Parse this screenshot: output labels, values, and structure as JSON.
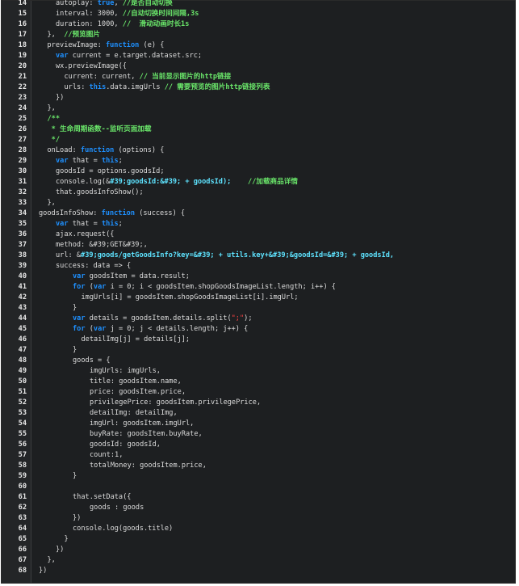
{
  "editor": {
    "lines": [
      {
        "n": "14",
        "indent": 2,
        "tokens": [
          {
            "t": "autoplay: "
          },
          {
            "t": "true",
            "c": "bool"
          },
          {
            "t": ", "
          },
          {
            "t": "//是否自动切换",
            "c": "cm"
          }
        ]
      },
      {
        "n": "15",
        "indent": 2,
        "tokens": [
          {
            "t": "interval: 3000, "
          },
          {
            "t": "//自动切换时间间隔,3s",
            "c": "cm"
          }
        ]
      },
      {
        "n": "16",
        "indent": 2,
        "tokens": [
          {
            "t": "duration: 1000, "
          },
          {
            "t": "//  滑动动画时长1s",
            "c": "cm"
          }
        ]
      },
      {
        "n": "17",
        "indent": 1,
        "tokens": [
          {
            "t": "},  "
          },
          {
            "t": "//预览图片",
            "c": "cm"
          }
        ]
      },
      {
        "n": "18",
        "indent": 1,
        "tokens": [
          {
            "t": "previewImage: "
          },
          {
            "t": "function",
            "c": "kw"
          },
          {
            "t": " (e) {"
          }
        ]
      },
      {
        "n": "19",
        "indent": 2,
        "tokens": [
          {
            "t": "var",
            "c": "kw"
          },
          {
            "t": " current = e.target.dataset.src;"
          }
        ]
      },
      {
        "n": "20",
        "indent": 2,
        "tokens": [
          {
            "t": "wx.previewImage({"
          }
        ]
      },
      {
        "n": "21",
        "indent": 3,
        "tokens": [
          {
            "t": "current: current, "
          },
          {
            "t": "// 当前显示图片的http链接",
            "c": "cm"
          }
        ]
      },
      {
        "n": "22",
        "indent": 3,
        "tokens": [
          {
            "t": "urls: "
          },
          {
            "t": "this",
            "c": "kw"
          },
          {
            "t": ".data.imgUrls "
          },
          {
            "t": "// 需要预览的图片http链接列表",
            "c": "cm"
          }
        ]
      },
      {
        "n": "23",
        "indent": 2,
        "tokens": [
          {
            "t": "})"
          }
        ]
      },
      {
        "n": "24",
        "indent": 1,
        "tokens": [
          {
            "t": "},"
          }
        ]
      },
      {
        "n": "25",
        "indent": 1,
        "tokens": [
          {
            "t": "/**",
            "c": "cm"
          }
        ]
      },
      {
        "n": "26",
        "indent": 1,
        "tokens": [
          {
            "t": " * 生命周期函数--监听页面加载",
            "c": "cm"
          }
        ]
      },
      {
        "n": "27",
        "indent": 1,
        "tokens": [
          {
            "t": " */",
            "c": "cm"
          }
        ]
      },
      {
        "n": "28",
        "indent": 1,
        "tokens": [
          {
            "t": "onLoad: "
          },
          {
            "t": "function",
            "c": "kw"
          },
          {
            "t": " (options) {"
          }
        ]
      },
      {
        "n": "29",
        "indent": 2,
        "tokens": [
          {
            "t": "var",
            "c": "kw"
          },
          {
            "t": " that = "
          },
          {
            "t": "this",
            "c": "kw"
          },
          {
            "t": ";"
          }
        ]
      },
      {
        "n": "30",
        "indent": 2,
        "tokens": [
          {
            "t": "goodsId = options.goodsId;"
          }
        ]
      },
      {
        "n": "31",
        "indent": 2,
        "tokens": [
          {
            "t": "console.log(&"
          },
          {
            "t": "#39;goodsId:&#39; + goodsId);",
            "c": "cy"
          },
          {
            "t": "    "
          },
          {
            "t": "//加载商品详情",
            "c": "cm"
          }
        ]
      },
      {
        "n": "32",
        "indent": 2,
        "tokens": [
          {
            "t": "that.goodsInfoShow();"
          }
        ]
      },
      {
        "n": "33",
        "indent": 1,
        "tokens": [
          {
            "t": "},"
          }
        ]
      },
      {
        "n": "34",
        "indent": 0,
        "tokens": [
          {
            "t": "goodsInfoShow: "
          },
          {
            "t": "function",
            "c": "kw"
          },
          {
            "t": " (success) {"
          }
        ]
      },
      {
        "n": "35",
        "indent": 2,
        "tokens": [
          {
            "t": "var",
            "c": "kw"
          },
          {
            "t": " that = "
          },
          {
            "t": "this",
            "c": "kw"
          },
          {
            "t": ";"
          }
        ]
      },
      {
        "n": "36",
        "indent": 2,
        "tokens": [
          {
            "t": "ajax.request({"
          }
        ]
      },
      {
        "n": "37",
        "indent": 2,
        "tokens": [
          {
            "t": "method: &#39;GET&#39;,"
          }
        ]
      },
      {
        "n": "38",
        "indent": 2,
        "tokens": [
          {
            "t": "url: &"
          },
          {
            "t": "#39;goods/getGoodsInfo?key=&#39; + utils.key+&#39;&goodsId=&#39; + goodsId,",
            "c": "cy"
          }
        ]
      },
      {
        "n": "39",
        "indent": 2,
        "tokens": [
          {
            "t": "success: data => {"
          }
        ]
      },
      {
        "n": "40",
        "indent": 4,
        "tokens": [
          {
            "t": "var",
            "c": "kw"
          },
          {
            "t": " goodsItem = data.result;"
          }
        ]
      },
      {
        "n": "41",
        "indent": 4,
        "tokens": [
          {
            "t": "for",
            "c": "kw"
          },
          {
            "t": " ("
          },
          {
            "t": "var",
            "c": "kw"
          },
          {
            "t": " i = 0; i < goodsItem.shopGoodsImageList.length; i++) {"
          }
        ]
      },
      {
        "n": "42",
        "indent": 5,
        "tokens": [
          {
            "t": "imgUrls[i] = goodsItem.shopGoodsImageList[i].imgUrl;"
          }
        ]
      },
      {
        "n": "43",
        "indent": 4,
        "tokens": [
          {
            "t": "}"
          }
        ]
      },
      {
        "n": "44",
        "indent": 4,
        "tokens": [
          {
            "t": "var",
            "c": "kw"
          },
          {
            "t": " details = goodsItem.details.split("
          },
          {
            "t": "\";\"",
            "c": "str"
          },
          {
            "t": ");"
          }
        ]
      },
      {
        "n": "45",
        "indent": 4,
        "tokens": [
          {
            "t": "for",
            "c": "kw"
          },
          {
            "t": " ("
          },
          {
            "t": "var",
            "c": "kw"
          },
          {
            "t": " j = 0; j < details.length; j++) {"
          }
        ]
      },
      {
        "n": "46",
        "indent": 5,
        "tokens": [
          {
            "t": "detailImg[j] = details[j];"
          }
        ]
      },
      {
        "n": "47",
        "indent": 4,
        "tokens": [
          {
            "t": "}"
          }
        ]
      },
      {
        "n": "48",
        "indent": 4,
        "tokens": [
          {
            "t": "goods = {"
          }
        ]
      },
      {
        "n": "49",
        "indent": 6,
        "tokens": [
          {
            "t": "imgUrls: imgUrls,"
          }
        ]
      },
      {
        "n": "50",
        "indent": 6,
        "tokens": [
          {
            "t": "title: goodsItem.name,"
          }
        ]
      },
      {
        "n": "51",
        "indent": 6,
        "tokens": [
          {
            "t": "price: goodsItem.price,"
          }
        ]
      },
      {
        "n": "52",
        "indent": 6,
        "tokens": [
          {
            "t": "privilegePrice: goodsItem.privilegePrice,"
          }
        ]
      },
      {
        "n": "53",
        "indent": 6,
        "tokens": [
          {
            "t": "detailImg: detailImg,"
          }
        ]
      },
      {
        "n": "54",
        "indent": 6,
        "tokens": [
          {
            "t": "imgUrl: goodsItem.imgUrl,"
          }
        ]
      },
      {
        "n": "55",
        "indent": 6,
        "tokens": [
          {
            "t": "buyRate: goodsItem.buyRate,"
          }
        ]
      },
      {
        "n": "56",
        "indent": 6,
        "tokens": [
          {
            "t": "goodsId: goodsId,"
          }
        ]
      },
      {
        "n": "57",
        "indent": 6,
        "tokens": [
          {
            "t": "count:1,"
          }
        ]
      },
      {
        "n": "58",
        "indent": 6,
        "tokens": [
          {
            "t": "totalMoney: goodsItem.price,"
          }
        ]
      },
      {
        "n": "59",
        "indent": 4,
        "tokens": [
          {
            "t": "}"
          }
        ]
      },
      {
        "n": "60",
        "indent": 0,
        "tokens": []
      },
      {
        "n": "61",
        "indent": 4,
        "tokens": [
          {
            "t": "that.setData({"
          }
        ]
      },
      {
        "n": "62",
        "indent": 6,
        "tokens": [
          {
            "t": "goods : goods"
          }
        ]
      },
      {
        "n": "63",
        "indent": 4,
        "tokens": [
          {
            "t": "})"
          }
        ]
      },
      {
        "n": "64",
        "indent": 4,
        "tokens": [
          {
            "t": "console.log(goods.title)"
          }
        ]
      },
      {
        "n": "65",
        "indent": 3,
        "tokens": [
          {
            "t": "}"
          }
        ]
      },
      {
        "n": "66",
        "indent": 2,
        "tokens": [
          {
            "t": "})"
          }
        ]
      },
      {
        "n": "67",
        "indent": 1,
        "tokens": [
          {
            "t": "},"
          }
        ]
      },
      {
        "n": "68",
        "indent": 0,
        "tokens": [
          {
            "t": "})"
          }
        ]
      }
    ]
  }
}
